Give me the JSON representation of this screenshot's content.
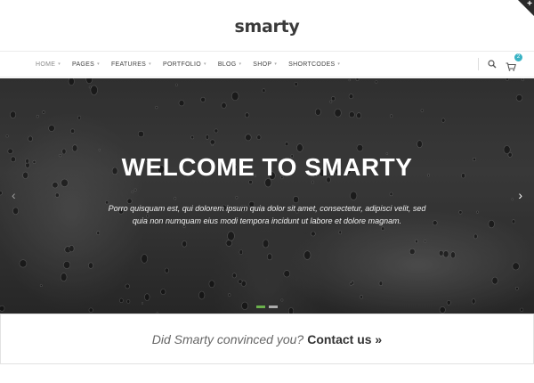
{
  "logo": {
    "text": "smarty"
  },
  "nav": {
    "items": [
      {
        "label": "HOME",
        "active": true
      },
      {
        "label": "PAGES",
        "active": false
      },
      {
        "label": "FEATURES",
        "active": false
      },
      {
        "label": "PORTFOLIO",
        "active": false
      },
      {
        "label": "BLOG",
        "active": false
      },
      {
        "label": "SHOP",
        "active": false
      },
      {
        "label": "SHORTCODES",
        "active": false
      }
    ],
    "search_icon": "search-icon",
    "cart_icon": "cart-icon",
    "cart_count": "2"
  },
  "hero": {
    "title": "WELCOME TO SMARTY",
    "text_line1": "Porro quisquam est, qui dolorem ipsum quia dolor sit amet, consectetur, adipisci velit, sed",
    "text_line2": "quia non numquam eius modi tempora incidunt ut labore et dolore magnam.",
    "prev_arrow": "‹",
    "next_arrow": "›",
    "slides": 2,
    "active_slide": 1
  },
  "cta": {
    "question": "Did Smarty convinced you?",
    "link_label": "Contact us »"
  },
  "colors": {
    "accent": "#3ab3c4",
    "slider_active": "#6ab04c"
  }
}
